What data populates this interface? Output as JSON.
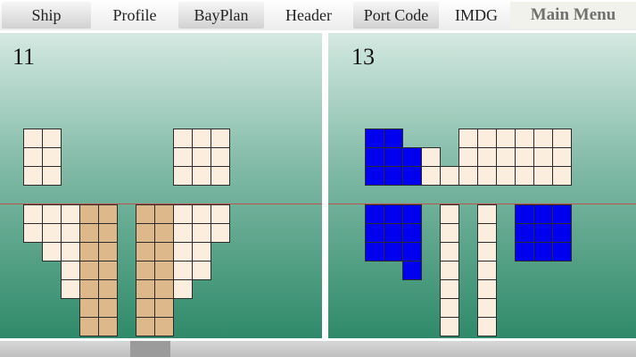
{
  "menu": {
    "items": [
      {
        "label": "Ship",
        "name": "menu-ship"
      },
      {
        "label": "Profile",
        "name": "menu-profile"
      },
      {
        "label": "BayPlan",
        "name": "menu-bayplan"
      },
      {
        "label": "Header",
        "name": "menu-header"
      },
      {
        "label": "Port Code",
        "name": "menu-port-code"
      },
      {
        "label": "IMDG",
        "name": "menu-imdg"
      }
    ],
    "main_menu": "Main Menu"
  },
  "bays": {
    "left": {
      "number": "11"
    },
    "right": {
      "number": "13"
    }
  },
  "colors": {
    "empty_slot": "#fbeede",
    "cargo_slot": "#dcb88a",
    "highlight_slot": "#0000ee",
    "deck_line": "#c0504d"
  }
}
